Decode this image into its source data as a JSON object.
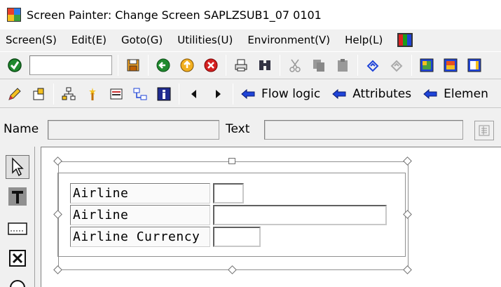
{
  "window": {
    "title": "Screen Painter:  Change Screen SAPLZSUB1_07 0101"
  },
  "menu": {
    "items": [
      "Screen(S)",
      "Edit(E)",
      "Goto(G)",
      "Utilities(U)",
      "Environment(V)",
      "Help(L)"
    ]
  },
  "toolbar2": {
    "flow_logic": "Flow logic",
    "attributes": "Attributes",
    "elements": "Elemen"
  },
  "namebar": {
    "name_label": "Name",
    "name_value": "",
    "text_label": "Text",
    "text_value": ""
  },
  "screen": {
    "fields": [
      {
        "label": "Airline"
      },
      {
        "label": "Airline"
      },
      {
        "label": "Airline Currency"
      }
    ]
  },
  "colors": {
    "accent_blue": "#1f44d8",
    "check_green": "#1f8a2e",
    "title_bg": "#ffffff"
  }
}
